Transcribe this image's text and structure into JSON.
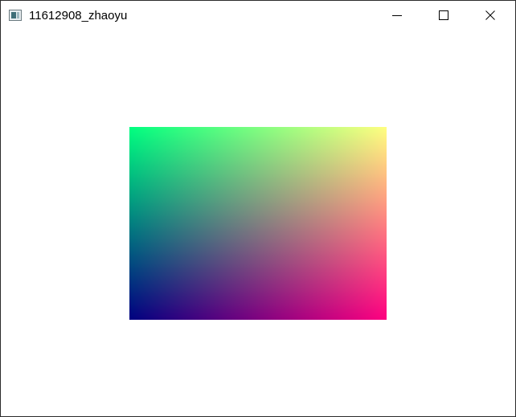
{
  "window": {
    "title": "11612908_zhaoyu",
    "icons": {
      "app": "app-window-icon",
      "minimize": "minimize-icon",
      "maximize": "maximize-icon",
      "close": "close-icon"
    }
  },
  "canvas": {
    "background": "#ffffff",
    "rectangle": {
      "corner_colors": {
        "top_left": "#00ff80",
        "top_right": "#ffff80",
        "bottom_left": "#000080",
        "bottom_right": "#ff0080"
      }
    }
  }
}
